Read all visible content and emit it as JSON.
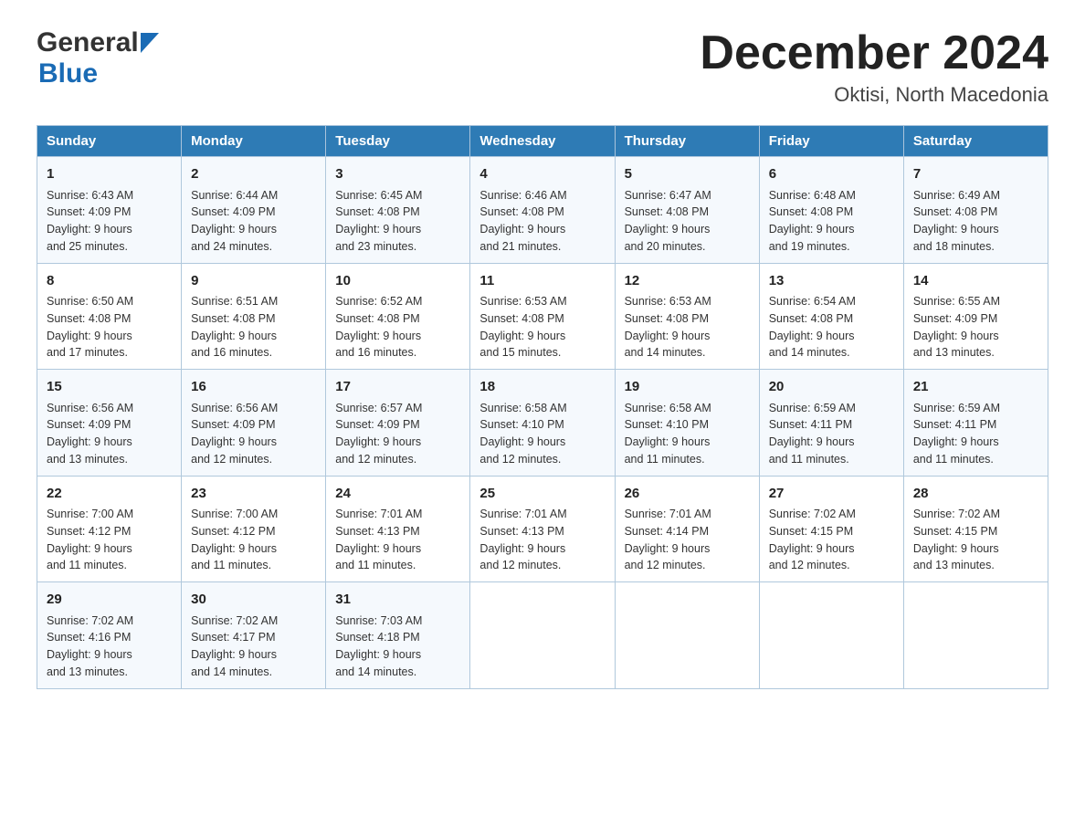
{
  "logo": {
    "top_text": "General",
    "bottom_text": "Blue"
  },
  "title": "December 2024",
  "subtitle": "Oktisi, North Macedonia",
  "days_of_week": [
    "Sunday",
    "Monday",
    "Tuesday",
    "Wednesday",
    "Thursday",
    "Friday",
    "Saturday"
  ],
  "weeks": [
    [
      {
        "day": "1",
        "lines": [
          "Sunrise: 6:43 AM",
          "Sunset: 4:09 PM",
          "Daylight: 9 hours",
          "and 25 minutes."
        ]
      },
      {
        "day": "2",
        "lines": [
          "Sunrise: 6:44 AM",
          "Sunset: 4:09 PM",
          "Daylight: 9 hours",
          "and 24 minutes."
        ]
      },
      {
        "day": "3",
        "lines": [
          "Sunrise: 6:45 AM",
          "Sunset: 4:08 PM",
          "Daylight: 9 hours",
          "and 23 minutes."
        ]
      },
      {
        "day": "4",
        "lines": [
          "Sunrise: 6:46 AM",
          "Sunset: 4:08 PM",
          "Daylight: 9 hours",
          "and 21 minutes."
        ]
      },
      {
        "day": "5",
        "lines": [
          "Sunrise: 6:47 AM",
          "Sunset: 4:08 PM",
          "Daylight: 9 hours",
          "and 20 minutes."
        ]
      },
      {
        "day": "6",
        "lines": [
          "Sunrise: 6:48 AM",
          "Sunset: 4:08 PM",
          "Daylight: 9 hours",
          "and 19 minutes."
        ]
      },
      {
        "day": "7",
        "lines": [
          "Sunrise: 6:49 AM",
          "Sunset: 4:08 PM",
          "Daylight: 9 hours",
          "and 18 minutes."
        ]
      }
    ],
    [
      {
        "day": "8",
        "lines": [
          "Sunrise: 6:50 AM",
          "Sunset: 4:08 PM",
          "Daylight: 9 hours",
          "and 17 minutes."
        ]
      },
      {
        "day": "9",
        "lines": [
          "Sunrise: 6:51 AM",
          "Sunset: 4:08 PM",
          "Daylight: 9 hours",
          "and 16 minutes."
        ]
      },
      {
        "day": "10",
        "lines": [
          "Sunrise: 6:52 AM",
          "Sunset: 4:08 PM",
          "Daylight: 9 hours",
          "and 16 minutes."
        ]
      },
      {
        "day": "11",
        "lines": [
          "Sunrise: 6:53 AM",
          "Sunset: 4:08 PM",
          "Daylight: 9 hours",
          "and 15 minutes."
        ]
      },
      {
        "day": "12",
        "lines": [
          "Sunrise: 6:53 AM",
          "Sunset: 4:08 PM",
          "Daylight: 9 hours",
          "and 14 minutes."
        ]
      },
      {
        "day": "13",
        "lines": [
          "Sunrise: 6:54 AM",
          "Sunset: 4:08 PM",
          "Daylight: 9 hours",
          "and 14 minutes."
        ]
      },
      {
        "day": "14",
        "lines": [
          "Sunrise: 6:55 AM",
          "Sunset: 4:09 PM",
          "Daylight: 9 hours",
          "and 13 minutes."
        ]
      }
    ],
    [
      {
        "day": "15",
        "lines": [
          "Sunrise: 6:56 AM",
          "Sunset: 4:09 PM",
          "Daylight: 9 hours",
          "and 13 minutes."
        ]
      },
      {
        "day": "16",
        "lines": [
          "Sunrise: 6:56 AM",
          "Sunset: 4:09 PM",
          "Daylight: 9 hours",
          "and 12 minutes."
        ]
      },
      {
        "day": "17",
        "lines": [
          "Sunrise: 6:57 AM",
          "Sunset: 4:09 PM",
          "Daylight: 9 hours",
          "and 12 minutes."
        ]
      },
      {
        "day": "18",
        "lines": [
          "Sunrise: 6:58 AM",
          "Sunset: 4:10 PM",
          "Daylight: 9 hours",
          "and 12 minutes."
        ]
      },
      {
        "day": "19",
        "lines": [
          "Sunrise: 6:58 AM",
          "Sunset: 4:10 PM",
          "Daylight: 9 hours",
          "and 11 minutes."
        ]
      },
      {
        "day": "20",
        "lines": [
          "Sunrise: 6:59 AM",
          "Sunset: 4:11 PM",
          "Daylight: 9 hours",
          "and 11 minutes."
        ]
      },
      {
        "day": "21",
        "lines": [
          "Sunrise: 6:59 AM",
          "Sunset: 4:11 PM",
          "Daylight: 9 hours",
          "and 11 minutes."
        ]
      }
    ],
    [
      {
        "day": "22",
        "lines": [
          "Sunrise: 7:00 AM",
          "Sunset: 4:12 PM",
          "Daylight: 9 hours",
          "and 11 minutes."
        ]
      },
      {
        "day": "23",
        "lines": [
          "Sunrise: 7:00 AM",
          "Sunset: 4:12 PM",
          "Daylight: 9 hours",
          "and 11 minutes."
        ]
      },
      {
        "day": "24",
        "lines": [
          "Sunrise: 7:01 AM",
          "Sunset: 4:13 PM",
          "Daylight: 9 hours",
          "and 11 minutes."
        ]
      },
      {
        "day": "25",
        "lines": [
          "Sunrise: 7:01 AM",
          "Sunset: 4:13 PM",
          "Daylight: 9 hours",
          "and 12 minutes."
        ]
      },
      {
        "day": "26",
        "lines": [
          "Sunrise: 7:01 AM",
          "Sunset: 4:14 PM",
          "Daylight: 9 hours",
          "and 12 minutes."
        ]
      },
      {
        "day": "27",
        "lines": [
          "Sunrise: 7:02 AM",
          "Sunset: 4:15 PM",
          "Daylight: 9 hours",
          "and 12 minutes."
        ]
      },
      {
        "day": "28",
        "lines": [
          "Sunrise: 7:02 AM",
          "Sunset: 4:15 PM",
          "Daylight: 9 hours",
          "and 13 minutes."
        ]
      }
    ],
    [
      {
        "day": "29",
        "lines": [
          "Sunrise: 7:02 AM",
          "Sunset: 4:16 PM",
          "Daylight: 9 hours",
          "and 13 minutes."
        ]
      },
      {
        "day": "30",
        "lines": [
          "Sunrise: 7:02 AM",
          "Sunset: 4:17 PM",
          "Daylight: 9 hours",
          "and 14 minutes."
        ]
      },
      {
        "day": "31",
        "lines": [
          "Sunrise: 7:03 AM",
          "Sunset: 4:18 PM",
          "Daylight: 9 hours",
          "and 14 minutes."
        ]
      },
      null,
      null,
      null,
      null
    ]
  ]
}
